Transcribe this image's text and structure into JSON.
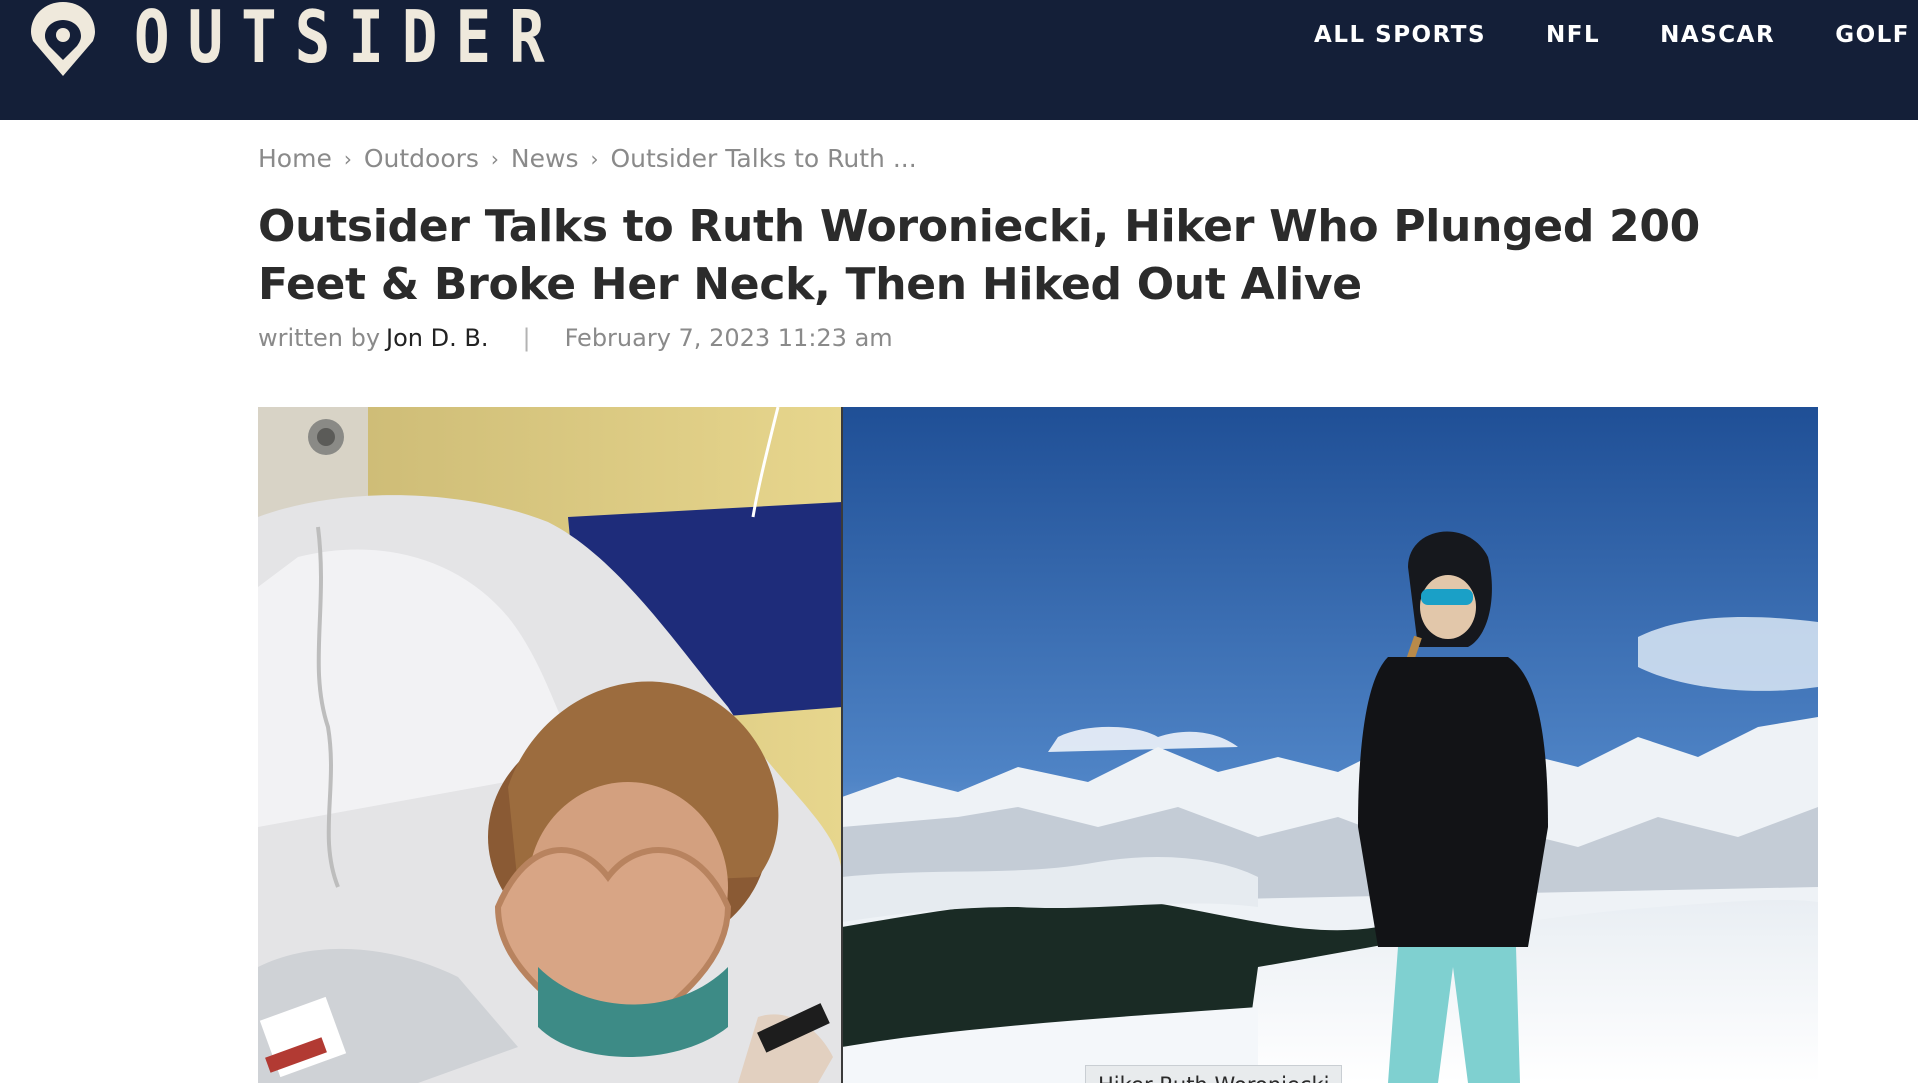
{
  "header": {
    "logo_text": "OUTSIDER",
    "logo_icon": "map-pin-icon",
    "nav": [
      {
        "label": "ALL SPORTS"
      },
      {
        "label": "NFL"
      },
      {
        "label": "NASCAR"
      },
      {
        "label": "GOLF"
      }
    ]
  },
  "breadcrumb": [
    {
      "label": "Home"
    },
    {
      "label": "Outdoors"
    },
    {
      "label": "News"
    },
    {
      "label": "Outsider Talks to Ruth ..."
    }
  ],
  "breadcrumb_separator": "›",
  "article": {
    "title": "Outsider Talks to Ruth Woroniecki, Hiker Who Plunged 200 Feet & Broke Her Neck, Then Hiked Out Alive",
    "written_by_label": "written by",
    "author": "Jon D. B.",
    "divider": "|",
    "date": "February 7, 2023 11:23 am",
    "image_caption": "Hiker Ruth Woroniecki"
  },
  "colors": {
    "header_bg": "#141f38",
    "logo_color": "#efe9dc",
    "title_color": "#2b2b2b",
    "meta_color": "#8a8a8a"
  }
}
